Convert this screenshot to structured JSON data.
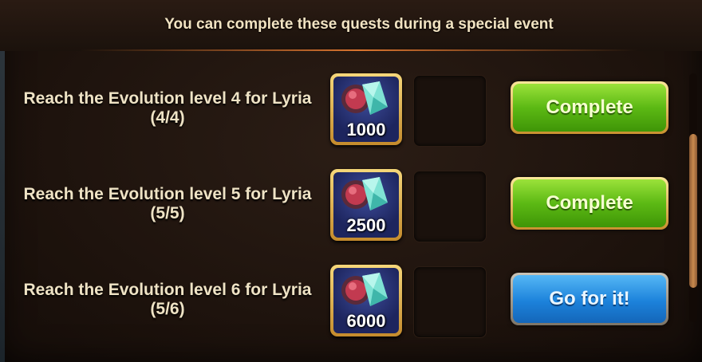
{
  "header": {
    "title": "You can complete these quests during a special event"
  },
  "quests": [
    {
      "text": "Reach the Evolution level 4 for Lyria",
      "progress": "(4/4)",
      "reward_icon": "evolution-gem-icon",
      "reward_amount": "1000",
      "button": {
        "label": "Complete",
        "style": "green"
      }
    },
    {
      "text": "Reach the Evolution level 5 for Lyria",
      "progress": "(5/5)",
      "reward_icon": "evolution-gem-icon",
      "reward_amount": "2500",
      "button": {
        "label": "Complete",
        "style": "green"
      }
    },
    {
      "text": "Reach the Evolution level 6 for Lyria",
      "progress": "(5/6)",
      "reward_icon": "evolution-gem-icon",
      "reward_amount": "6000",
      "button": {
        "label": "Go for it!",
        "style": "blue"
      }
    }
  ],
  "scrollbar": {
    "position_fraction": 0.64,
    "visible_fraction": 0.62
  },
  "colors": {
    "accent_green": "#5cb914",
    "accent_blue": "#1c82db",
    "frame_gold": "#d9a441",
    "header_line": "#d9742f"
  }
}
